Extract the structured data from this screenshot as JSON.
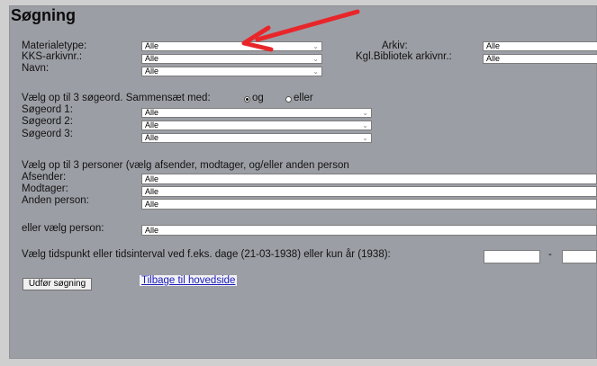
{
  "title": "Søgning",
  "fields": {
    "materialetype": {
      "label": "Materialetype:",
      "value": "Alle"
    },
    "kks": {
      "label": "KKS-arkivnr.:",
      "value": "Alle"
    },
    "navn": {
      "label": "Navn:",
      "value": "Alle"
    },
    "arkiv": {
      "label": "Arkiv:",
      "value": "Alle"
    },
    "kgl": {
      "label": "Kgl.Bibliotek arkivnr.:",
      "value": "Alle"
    }
  },
  "search_words": {
    "heading": "Vælg op til 3 søgeord. Sammensæt med:",
    "option_og": "og",
    "option_eller": "eller",
    "selected": "og",
    "rows": [
      {
        "label": "Søgeord 1:",
        "value": "Alle"
      },
      {
        "label": "Søgeord 2:",
        "value": "Alle"
      },
      {
        "label": "Søgeord 3:",
        "value": "Alle"
      }
    ]
  },
  "persons": {
    "heading": "Vælg op til 3 personer (vælg afsender, modtager, og/eller anden person",
    "rows": [
      {
        "label": "Afsender:",
        "value": "Alle"
      },
      {
        "label": "Modtager:",
        "value": "Alle"
      },
      {
        "label": "Anden person:",
        "value": "Alle"
      }
    ]
  },
  "person_choice": {
    "label": "eller vælg person:",
    "value": "Alle"
  },
  "date": {
    "label": "Vælg tidspunkt eller tidsinterval ved f.eks. dage (21-03-1938) eller kun år (1938):",
    "separator": "-",
    "from": "",
    "to": ""
  },
  "actions": {
    "submit": "Udfør søgning",
    "back_link": "Tilbage til hovedside"
  },
  "annotation": {
    "arrow_color": "#e8262a"
  }
}
